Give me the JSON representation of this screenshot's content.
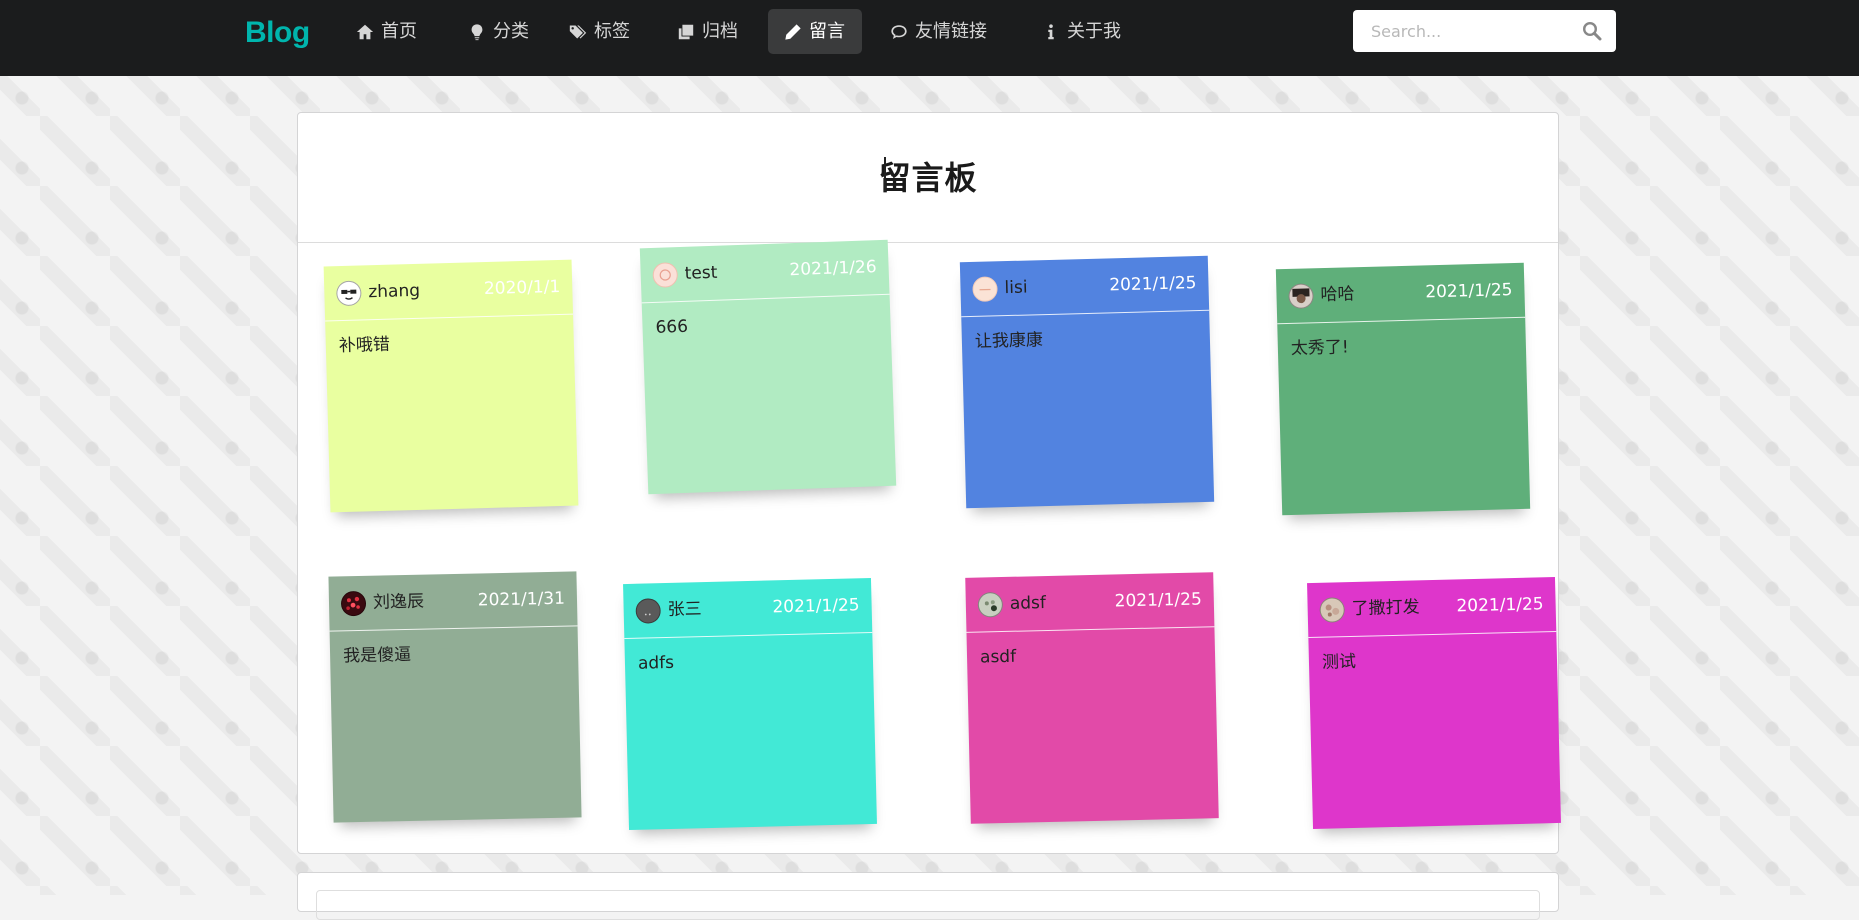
{
  "brand": "Blog",
  "nav": [
    {
      "label": "首页",
      "icon": "home-icon"
    },
    {
      "label": "分类",
      "icon": "lightbulb-icon"
    },
    {
      "label": "标签",
      "icon": "tags-icon"
    },
    {
      "label": "归档",
      "icon": "clone-icon"
    },
    {
      "label": "留言",
      "icon": "pencil-icon",
      "active": true
    },
    {
      "label": "友情链接",
      "icon": "comment-icon"
    },
    {
      "label": "关于我",
      "icon": "info-icon"
    }
  ],
  "search": {
    "placeholder": "Search..."
  },
  "board": {
    "title": "留言板"
  },
  "notes": [
    {
      "name": "zhang",
      "date": "2020/1/1",
      "content": "补哦错",
      "color": "#e9ffa0"
    },
    {
      "name": "test",
      "date": "2021/1/26",
      "content": "666",
      "color": "#b1ebc2"
    },
    {
      "name": "lisi",
      "date": "2021/1/25",
      "content": "让我康康",
      "color": "#5283e0"
    },
    {
      "name": "哈哈",
      "date": "2021/1/25",
      "content": "太秀了!",
      "color": "#5faf7a"
    },
    {
      "name": "刘逸辰",
      "date": "2021/1/31",
      "content": "我是傻逼",
      "color": "#91ad95"
    },
    {
      "name": "张三",
      "date": "2021/1/25",
      "content": "adfs",
      "color": "#42e9d6"
    },
    {
      "name": "adsf",
      "date": "2021/1/25",
      "content": "asdf",
      "color": "#e24aa8"
    },
    {
      "name": "了撒打发",
      "date": "2021/1/25",
      "content": "测试",
      "color": "#de36cb"
    }
  ]
}
